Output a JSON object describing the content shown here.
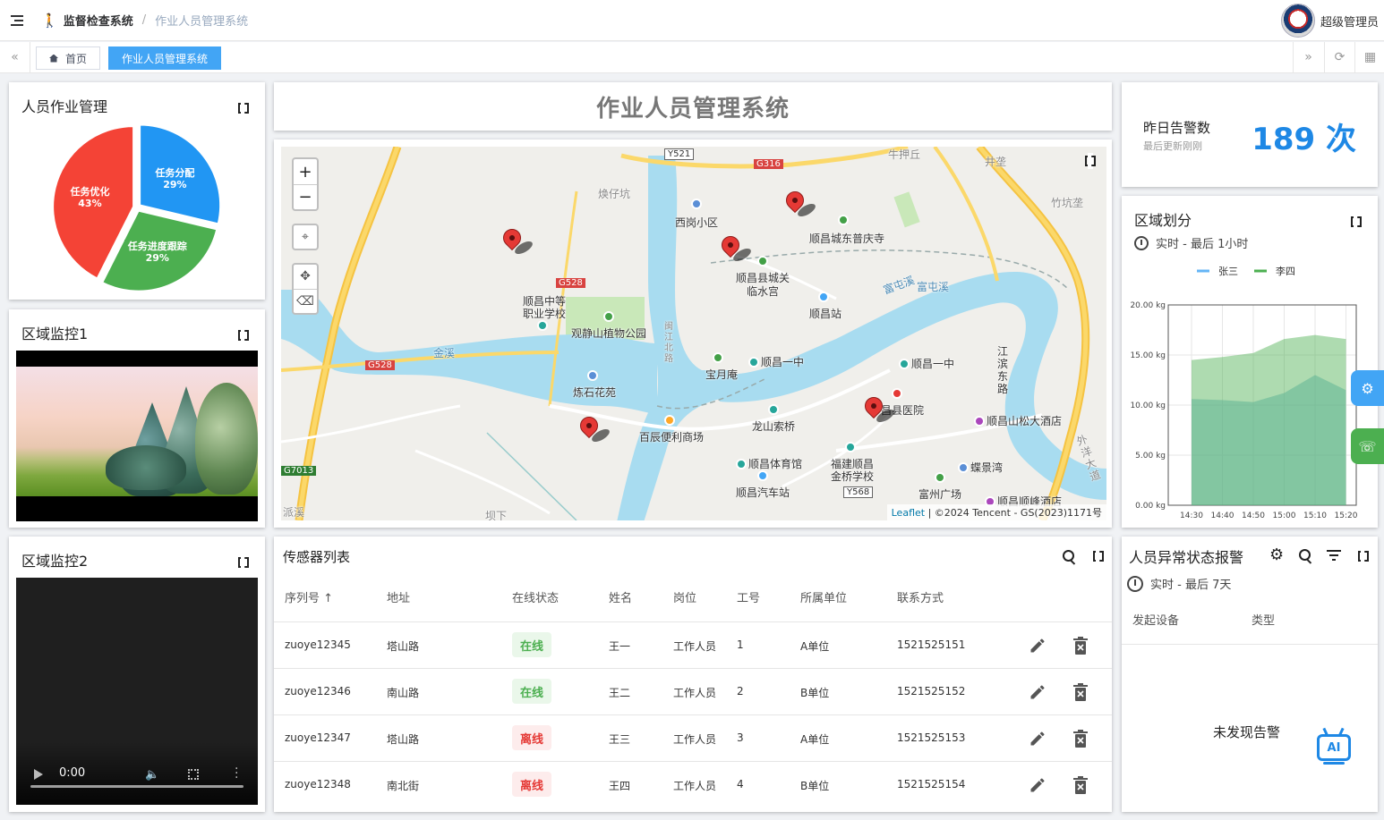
{
  "navbar": {
    "breadcrumb_root": "监督检查系统",
    "breadcrumb_current": "作业人员管理系统",
    "user_name": "超级管理员"
  },
  "tabs": [
    {
      "label": "首页"
    },
    {
      "label": "作业人员管理系统"
    }
  ],
  "pie_panel": {
    "title": "人员作业管理",
    "slices": [
      {
        "name": "任务分配",
        "percent": 29,
        "color": "#2196f3"
      },
      {
        "name": "任务进度跟踪",
        "percent": 29,
        "color": "#4caf50"
      },
      {
        "name": "任务优化",
        "percent": 43,
        "color": "#f44336"
      }
    ]
  },
  "monitor1": {
    "title": "区域监控1"
  },
  "monitor2": {
    "title": "区域监控2",
    "time": "0:00"
  },
  "page_title": "作业人员管理系统",
  "map": {
    "attribution_link": "Leaflet",
    "attribution_text": " | ©2024 Tencent - GS(2023)1171号",
    "labels": {
      "l1": "牛押丘",
      "l2": "井垄",
      "l3": "竹坑垄",
      "l4": "焕仔坑",
      "l5": "西岗小区",
      "l6": "顺昌城东普庆寺",
      "l7": "顺昌县城关",
      "l8": "临水宫",
      "l9": "顺昌中等",
      "l10": "职业学校",
      "l11": "观静山植物公园",
      "l12": "顺昌站",
      "l13": "顺昌一中",
      "l14": "顺昌一中",
      "l15": "宝月庵",
      "l16": "炼石花苑",
      "l17": "昌县医院",
      "l18": "顺昌山松大酒店",
      "l19": "龙山索桥",
      "l20": "百辰便利商场",
      "l21": "顺昌体育馆",
      "l22": "福建顺昌",
      "l23": "金桥学校",
      "l24": "蝶景湾",
      "l25": "顺昌汽车站",
      "l26": "富州广场",
      "l27": "顺昌顺峰酒店",
      "l28": "派溪",
      "l29": "坝下",
      "l30": "江滨东路",
      "l31": "富屯溪",
      "l32": "富屯溪",
      "l33": "外洋大道",
      "l34": "金溪",
      "l35": "闽江北路"
    },
    "roads": {
      "r1": "Y521",
      "r2": "G316",
      "r3": "G528",
      "r4": "G528",
      "r5": "G7013",
      "r6": "Y568"
    }
  },
  "alarm": {
    "label": "昨日告警数",
    "sub": "最后更新刚刚",
    "count": "189 次"
  },
  "area_chart_panel": {
    "title": "区域划分",
    "subtitle": "实时 - 最后 1小时"
  },
  "chart_data": {
    "type": "area",
    "x": [
      "14:30",
      "14:40",
      "14:50",
      "15:00",
      "15:10",
      "15:20"
    ],
    "ylim": [
      0,
      20
    ],
    "yticks": [
      "0.00 kg",
      "5.00 kg",
      "10.00 kg",
      "15.00 kg",
      "20.00 kg"
    ],
    "series": [
      {
        "name": "张三",
        "color": "#64b5f6",
        "values": [
          10.6,
          10.5,
          10.3,
          11.2,
          13.0,
          11.5
        ]
      },
      {
        "name": "李四",
        "color": "#4caf50",
        "values": [
          14.5,
          14.8,
          15.2,
          16.6,
          17.0,
          16.6
        ]
      }
    ]
  },
  "sensor_table": {
    "title": "传感器列表",
    "headers": [
      "序列号",
      "地址",
      "在线状态",
      "姓名",
      "岗位",
      "工号",
      "所属单位",
      "联系方式"
    ],
    "rows": [
      {
        "id": "zuoye12345",
        "addr": "塔山路",
        "status": "在线",
        "name": "王一",
        "post": "工作人员",
        "no": "1",
        "unit": "A单位",
        "phone": "1521525151"
      },
      {
        "id": "zuoye12346",
        "addr": "南山路",
        "status": "在线",
        "name": "王二",
        "post": "工作人员",
        "no": "2",
        "unit": "B单位",
        "phone": "1521525152"
      },
      {
        "id": "zuoye12347",
        "addr": "塔山路",
        "status": "离线",
        "name": "王三",
        "post": "工作人员",
        "no": "3",
        "unit": "A单位",
        "phone": "1521525153"
      },
      {
        "id": "zuoye12348",
        "addr": "南北街",
        "status": "离线",
        "name": "王四",
        "post": "工作人员",
        "no": "4",
        "unit": "B单位",
        "phone": "1521525154"
      }
    ]
  },
  "abnormal_panel": {
    "title": "人员异常状态报警",
    "subtitle": "实时 - 最后 7天",
    "col1": "发起设备",
    "col2": "类型",
    "empty": "未发现告警",
    "ai_label": "AI"
  }
}
